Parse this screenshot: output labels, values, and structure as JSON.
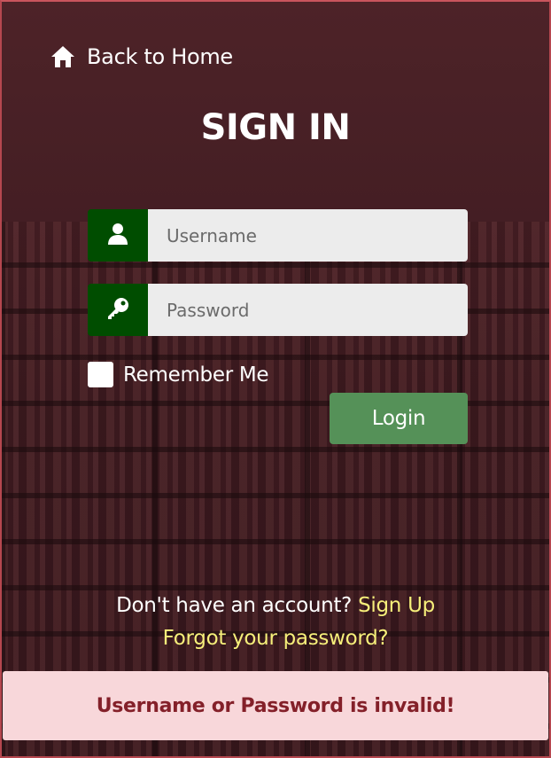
{
  "nav": {
    "back_label": "Back to Home",
    "back_icon": "home-icon"
  },
  "form": {
    "title": "SIGN IN",
    "username": {
      "placeholder": "Username",
      "value": "",
      "icon": "user-icon"
    },
    "password": {
      "placeholder": "Password",
      "value": "",
      "icon": "key-icon"
    },
    "remember_label": "Remember Me",
    "remember_checked": false,
    "login_label": "Login"
  },
  "footer": {
    "signup_prompt": "Don't have an account?",
    "signup_link": "Sign Up",
    "forgot_link": "Forgot your password?"
  },
  "alert": {
    "message": "Username or Password is invalid!"
  },
  "colors": {
    "addon_green": "#004d00",
    "button_green": "#559158",
    "link_yellow": "#f6ef7a",
    "alert_bg": "#f8d7da",
    "alert_text": "#842029"
  }
}
